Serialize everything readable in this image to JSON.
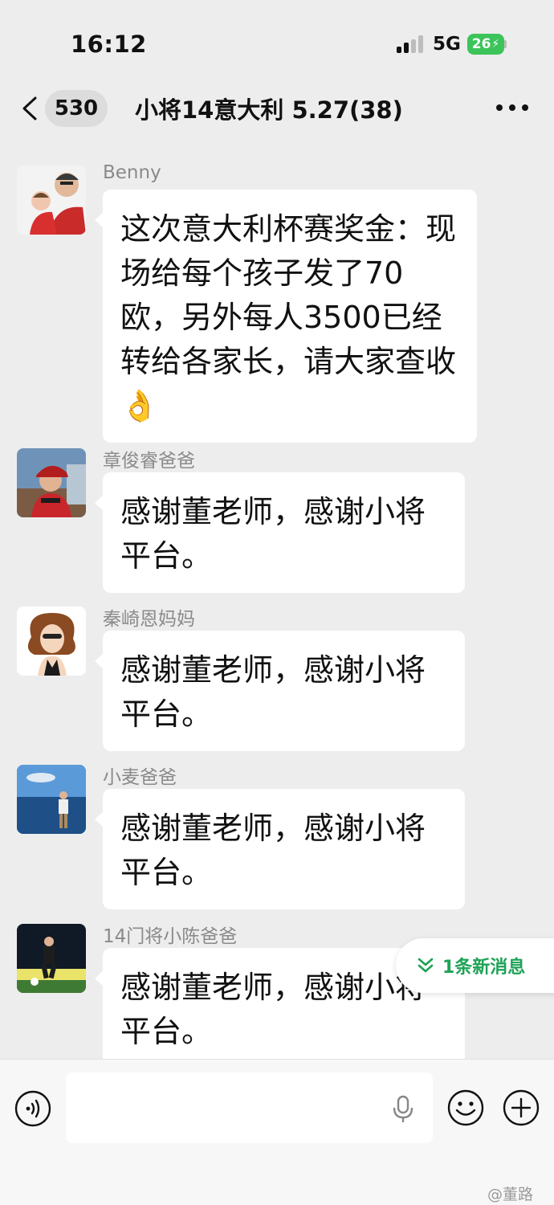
{
  "status_bar": {
    "time": "16:12",
    "network": "5G",
    "battery": "26"
  },
  "nav": {
    "unread_count": "530",
    "title": "小将14意大利 5.27(38)"
  },
  "messages": [
    {
      "sender": "Benny",
      "text": "这次意大利杯赛奖金：现场给每个孩子发了70欧，另外每人3500已经转给各家长，请大家查收👌",
      "avatar_icon": "man-holding-baby-avatar"
    },
    {
      "sender": "章俊睿爸爸",
      "text": "感谢董老师，感谢小将平台。",
      "avatar_icon": "boy-red-cap-avatar"
    },
    {
      "sender": "秦崎恩妈妈",
      "text": "感谢董老师，感谢小将平台。",
      "avatar_icon": "cartoon-woman-avatar"
    },
    {
      "sender": "小麦爸爸",
      "text": "感谢董老师，感谢小将平台。",
      "avatar_icon": "man-by-sea-avatar"
    },
    {
      "sender": "14门将小陈爸爸",
      "text": "感谢董老师，感谢小将平台。",
      "avatar_icon": "goalkeeper-avatar"
    }
  ],
  "new_messages_pill": "1条新消息",
  "input": {
    "placeholder": ""
  },
  "watermark": "@董路",
  "colors": {
    "background": "#ededed",
    "bubble": "#ffffff",
    "accent_green": "#1ea255",
    "battery_green": "#3cc45a"
  }
}
